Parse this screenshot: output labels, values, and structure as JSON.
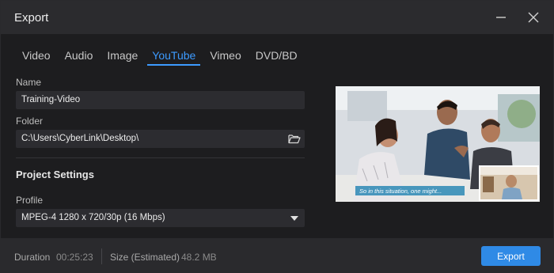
{
  "window": {
    "title": "Export"
  },
  "tabs": [
    "Video",
    "Audio",
    "Image",
    "YouTube",
    "Vimeo",
    "DVD/BD"
  ],
  "active_tab": "YouTube",
  "name": {
    "label": "Name",
    "value": "Training-Video"
  },
  "folder": {
    "label": "Folder",
    "value": "C:\\Users\\CyberLink\\Desktop\\"
  },
  "project_settings": {
    "title": "Project Settings"
  },
  "profile": {
    "label": "Profile",
    "value": "MPEG-4 1280 x 720/30p (16 Mbps)"
  },
  "preview": {
    "caption": "So in this situation, one might..."
  },
  "footer": {
    "duration_label": "Duration",
    "duration_value": "00:25:23",
    "size_label": "Size (Estimated)",
    "size_value": "48.2 MB",
    "export_label": "Export"
  },
  "colors": {
    "accent": "#2f8ae6",
    "tab_active": "#3d9bff",
    "background": "#1d1d1f"
  },
  "icons": {
    "minimize": "minimize-icon",
    "close": "close-icon",
    "folder": "folder-open-icon",
    "dropdown": "dropdown-arrow-icon"
  }
}
